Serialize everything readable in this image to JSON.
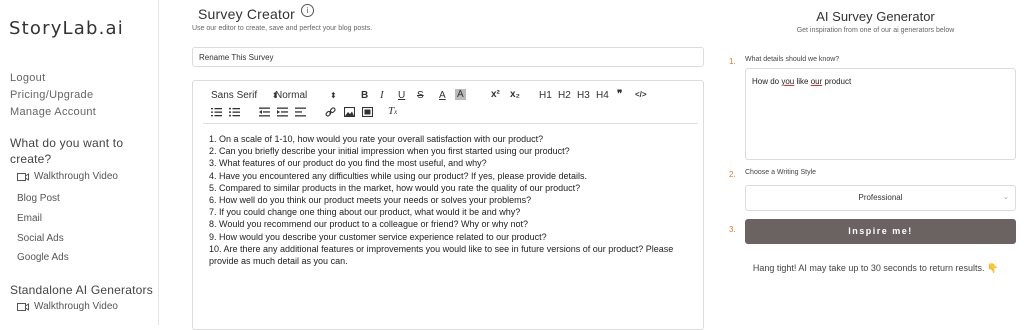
{
  "sidebar": {
    "logo": "StoryLab.ai",
    "account_links": [
      "Logout",
      "Pricing/Upgrade",
      "Manage Account"
    ],
    "section1_title_line1": "What do you want to",
    "section1_title_line2": "create?",
    "walkthrough_label": "Walkthrough Video",
    "items": [
      "Blog Post",
      "Email",
      "Social Ads",
      "Google Ads"
    ],
    "section2_title": "Standalone AI Generators",
    "walkthrough2_label": "Walkthrough Video"
  },
  "main": {
    "title": "Survey Creator",
    "subtitle": "Use our editor to create, save and perfect your blog posts.",
    "survey_name": "Rename This Survey",
    "toolbar": {
      "font": "Sans Serif",
      "size": "Normal",
      "h1": "H1",
      "h2": "H2",
      "h3": "H3",
      "h4": "H4",
      "sup": "x²",
      "sub": "x₂",
      "quote": "❞",
      "code": "</>"
    },
    "content_lines": [
      "1. On a scale of 1-10, how would you rate your overall satisfaction with our product?",
      "2. Can you briefly describe your initial impression when you first started using our product?",
      "3. What features of our product do you find the most useful, and why?",
      "4. Have you encountered any difficulties while using our product? If yes, please provide details.",
      "5. Compared to similar products in the market, how would you rate the quality of our product?",
      "6. How well do you think our product meets your needs or solves your problems?",
      "7. If you could change one thing about our product, what would it be and why?",
      "8. Would you recommend our product to a colleague or friend? Why or why not?",
      "9. How would you describe your customer service experience related to our product?",
      "10. Are there any additional features or improvements you would like to see in future versions of our product? Please provide as much detail as you can."
    ]
  },
  "right": {
    "title": "AI Survey Generator",
    "subtitle": "Get inspiration from one of our ai generators below",
    "step1_num": "1.",
    "step1_label": "What details should we know?",
    "details_text_part1": "How do ",
    "details_text_you": "you",
    "details_text_part2": " like ",
    "details_text_our": "our",
    "details_text_part3": " product",
    "step2_num": "2.",
    "step2_label": "Choose a Writing Style",
    "style_value": "Professional",
    "step3_num": "3.",
    "inspire_label": "Inspire me!",
    "wait_text": "Hang tight! AI may take up to 30 seconds to return results. 👇"
  },
  "colors": {
    "accent": "#e07b2a",
    "button": "#6b6361"
  }
}
